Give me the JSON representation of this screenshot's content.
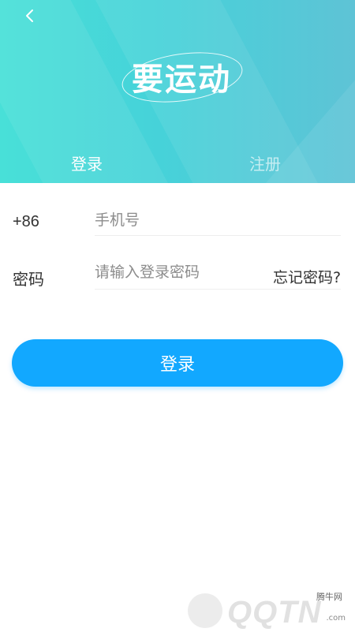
{
  "header": {
    "app_name": "要运动",
    "back_icon": "chevron-left-icon",
    "tabs": [
      {
        "label": "登录",
        "active": true
      },
      {
        "label": "注册",
        "active": false
      }
    ],
    "gradient_colors": [
      "#48e0d8",
      "#5ec3d6"
    ]
  },
  "form": {
    "phone_prefix": "+86",
    "phone_placeholder": "手机号",
    "phone_value": "",
    "password_label": "密码",
    "password_placeholder": "请输入登录密码",
    "password_value": "",
    "forgot_label": "忘记密码?"
  },
  "login_button": {
    "label": "登录",
    "color": "#12a8ff"
  },
  "watermark": {
    "brand": "QQTN",
    "site_name": "腾牛网",
    "url": ".com"
  }
}
